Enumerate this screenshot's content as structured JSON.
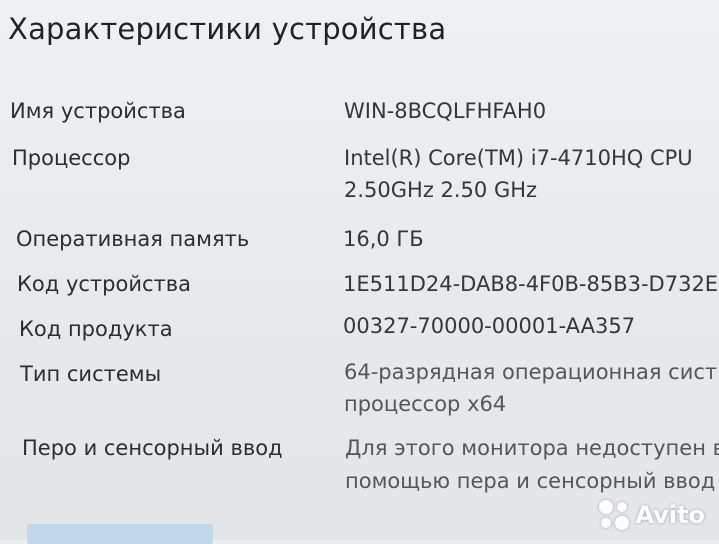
{
  "title": "Характеристики устройства",
  "rows": [
    {
      "label": "Имя устройства",
      "value": [
        "WIN-8BCQLFHFAH0"
      ]
    },
    {
      "label": "Процессор",
      "value": [
        "Intel(R) Core(TM) i7-4710HQ CPU",
        "2.50GHz   2.50 GHz"
      ]
    },
    {
      "label": "Оперативная память",
      "value": [
        "16,0 ГБ"
      ]
    },
    {
      "label": "Код устройства",
      "value": [
        "1E511D24-DAB8-4F0B-85B3-D732E"
      ]
    },
    {
      "label": "Код продукта",
      "value": [
        "00327-70000-00001-AA357"
      ]
    },
    {
      "label": "Тип системы",
      "value": [
        "64-разрядная операционная сист",
        "процессор x64"
      ]
    },
    {
      "label": "Перо и сенсорный ввод",
      "value": [
        "Для этого монитора недоступен в",
        "помощью пера и сенсорный ввод"
      ]
    }
  ],
  "watermark": {
    "text": "Avito",
    "icon": "avito-dots-icon"
  }
}
